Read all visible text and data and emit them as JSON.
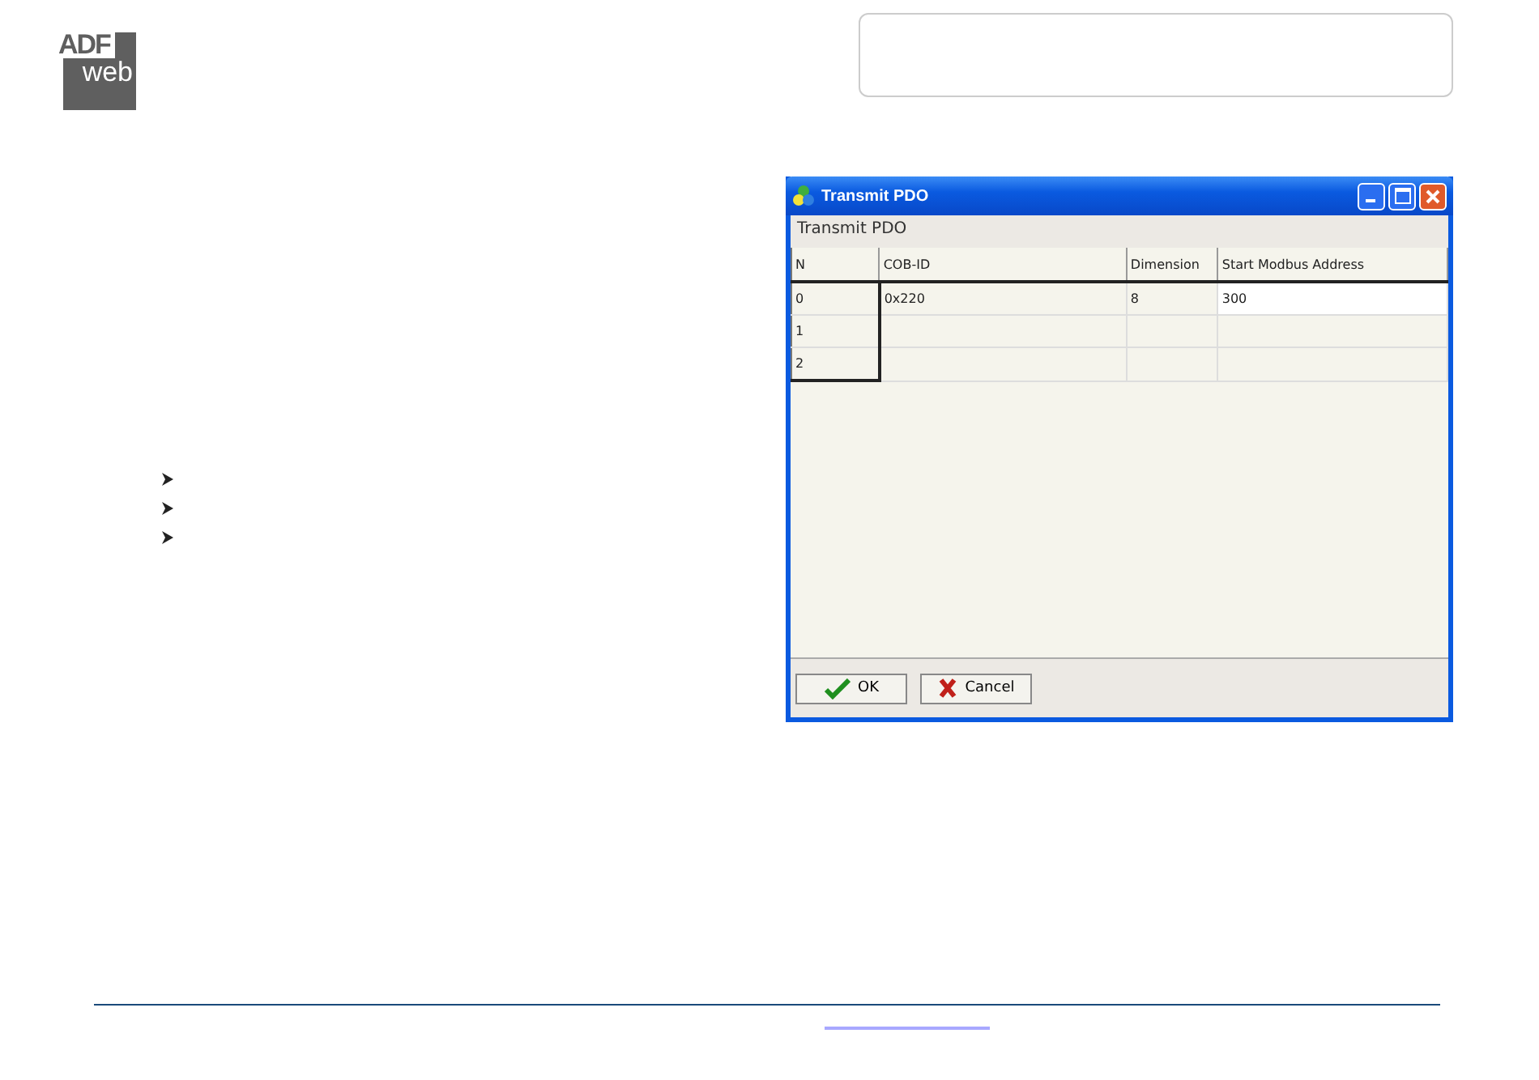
{
  "logo": {
    "line_1": "ADF",
    "line_2": "web"
  },
  "bullets": [
    {
      "kind": "arrow"
    },
    {
      "kind": "arrow"
    },
    {
      "kind": "arrow"
    }
  ],
  "window": {
    "title": "Transmit PDO",
    "section_label": "Transmit PDO",
    "table": {
      "columns": [
        "N",
        "COB-ID",
        "Dimension",
        "Start Modbus Address"
      ],
      "rows": [
        {
          "selected": true,
          "cells": [
            "0",
            "0x220",
            "8",
            "300"
          ]
        },
        {
          "selected": false,
          "cells": [
            "1",
            "",
            "",
            ""
          ]
        },
        {
          "selected": false,
          "cells": [
            "2",
            "",
            "",
            ""
          ]
        }
      ]
    },
    "buttons": [
      {
        "kind": "ok",
        "label": "OK"
      },
      {
        "kind": "cancel",
        "label": "Cancel"
      }
    ]
  }
}
